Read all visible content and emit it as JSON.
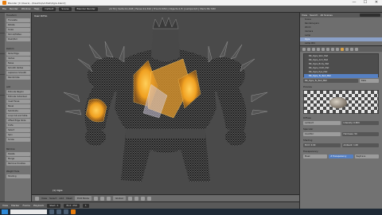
{
  "window": {
    "title": "Blender [C:\\Users\\...\\Desktop\\Artlab\\Ogre.blend]",
    "controls": [
      "—",
      "☐",
      "✕"
    ]
  },
  "menubar": {
    "items": [
      "File",
      "Render",
      "Window",
      "Help"
    ],
    "layout": "Default",
    "scene": "Scene",
    "engine": "Blender Render",
    "stats": "v2.79 | Verts:11,418 | Faces:11,342 | Tris:22,650 | Objects:1/5 | Lamps:0/2 | Mem:36.74M"
  },
  "toolshelf": {
    "sections": [
      {
        "title": "Transform",
        "buttons": [
          "Translate",
          "Rotate",
          "Scale",
          "Shrink/Fatten",
          "Push/Pull"
        ]
      },
      {
        "title": "Deform",
        "buttons": [
          "Slide Edge",
          "Vertex",
          "Noise",
          "Smooth Vertex",
          "Laplacian Smooth",
          "Randomize"
        ]
      },
      {
        "title": "Add",
        "buttons": [
          "Extrude Region",
          "Extrude Individual",
          "Inset Faces",
          "Bevel",
          "Subdivide",
          "Loop Cut and Slide",
          "Offset Edge Slide",
          "Knife",
          "Select",
          "Spin",
          "Screw"
        ]
      },
      {
        "title": "Remove",
        "buttons": [
          "Delete",
          "Merge",
          "Remove Doubles"
        ]
      },
      {
        "title": "Weight Tools",
        "buttons": [
          "Shading"
        ]
      }
    ]
  },
  "viewport": {
    "label": "User Ortho",
    "object_label": "(1) Ogre",
    "header": {
      "items": [
        "View",
        "Select",
        "Add",
        "Mesh"
      ],
      "mode": "Edit Mode",
      "pivot": "Global"
    }
  },
  "timeline": {
    "items": [
      "View",
      "Marker",
      "Frame",
      "Playback"
    ],
    "start_label": "Start: 1",
    "end_label": "End: 250",
    "current": "1"
  },
  "outliner": {
    "header_items": [
      "View",
      "Search",
      "All Scenes"
    ],
    "rows": [
      "Scene",
      "RenderLayers",
      "World",
      "Camera",
      "Lamp",
      "Ogre",
      "Lamp.001"
    ],
    "selected_index": 5
  },
  "properties": {
    "materials": [
      "BR_Ogre_Skin_Mat",
      "BR_Ogre_Arm_Mat",
      "BR_Ogre_Body_Mat",
      "BR_Ogre_Cloth_Mat",
      "BR_Ogre_Eye_Mat",
      "BR_Ogre_Tu_Red_Mat"
    ],
    "selected_material": 5,
    "material_name": "BR_Ogre_Tu_Red_Mat",
    "data_label": "Data",
    "preview_title": "Preview",
    "diffuse_title": "Diffuse",
    "diffuse_shader": "Lambert",
    "intensity_label": "Intensity: 0.800",
    "specular_title": "Specular",
    "specular_shader": "CookTorr",
    "hardness_label": "Hardness: 50",
    "shading_title": "Shading",
    "emit_label": "Emit: 0.00",
    "ambient_label": "Ambient: 1.00",
    "transparency_title": "Transparency",
    "transparency_modes": [
      "Mask",
      "Z Transparency",
      "Raytrace"
    ]
  },
  "taskbar": {
    "search_placeholder": "",
    "tray_text": ""
  },
  "colors": {
    "accent": "#e87d0d",
    "selection": "#5680c2",
    "orange_mesh": "#f0a020"
  }
}
